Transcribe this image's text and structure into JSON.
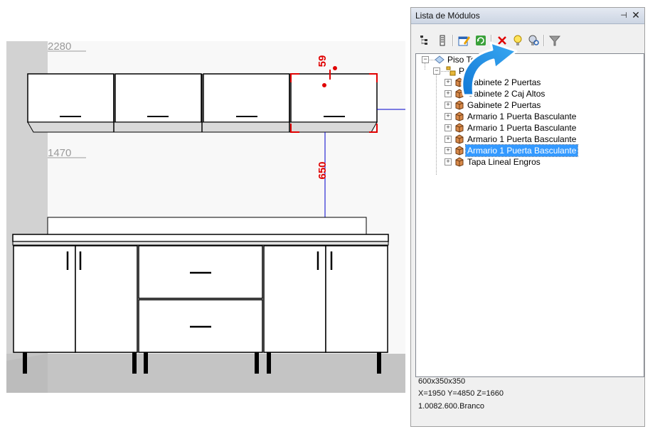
{
  "viewport": {
    "dimensions": {
      "top_height": "2280",
      "mid_height": "1470",
      "gap_label": "59",
      "cabinet_gap": "650"
    }
  },
  "panel": {
    "title": "Lista de Módulos",
    "pin_icon": "pin-icon",
    "close_icon": "close-icon",
    "toolbar": [
      {
        "name": "tree-hierarchy-icon"
      },
      {
        "name": "list-icon"
      },
      {
        "name": "edit-properties-icon"
      },
      {
        "name": "refresh-icon"
      },
      {
        "name": "delete-icon"
      },
      {
        "name": "lightbulb-icon"
      },
      {
        "name": "lightbulb-search-icon"
      },
      {
        "name": "filter-icon"
      }
    ],
    "tree": {
      "root": {
        "label": "Piso Techo"
      },
      "group": {
        "label": "Pa"
      },
      "items": [
        {
          "label": "Gabinete 2 Puertas"
        },
        {
          "label": "Gabinete 2 Caj Altos"
        },
        {
          "label": "Gabinete 2 Puertas"
        },
        {
          "label": "Armario 1 Puerta Basculante"
        },
        {
          "label": "Armario 1 Puerta Basculante"
        },
        {
          "label": "Armario 1 Puerta Basculante"
        },
        {
          "label": "Armario 1 Puerta Basculante",
          "selected": true
        },
        {
          "label": "Tapa Lineal Engros"
        }
      ]
    },
    "info": {
      "size": "600x350x350",
      "position": "X=1950  Y=4850  Z=1660",
      "material": "1.0082.600.Branco"
    }
  },
  "colors": {
    "selection": "#3399ff",
    "dimension_red": "#e00000",
    "dimension_blue": "#0000cc",
    "arrow_blue": "#1a8fe0"
  }
}
